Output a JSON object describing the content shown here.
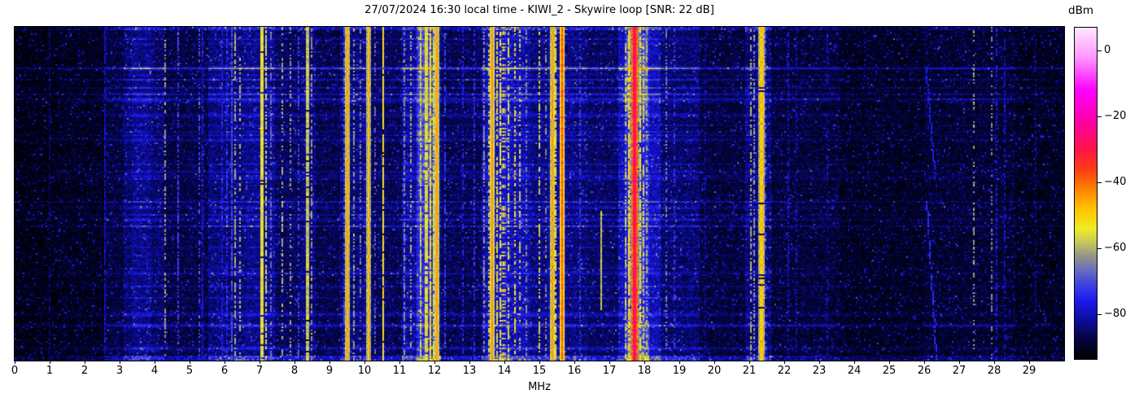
{
  "chart_data": {
    "type": "heatmap",
    "subtype": "radio-spectrogram-waterfall",
    "title": "27/07/2024 16:30 local time - KIWI_2 - Skywire loop [SNR: 22 dB]",
    "xlabel": "MHz",
    "x_range": [
      0,
      30
    ],
    "x_ticks": [
      0,
      1,
      2,
      3,
      4,
      5,
      6,
      7,
      8,
      9,
      10,
      11,
      12,
      13,
      14,
      15,
      16,
      17,
      18,
      19,
      20,
      21,
      22,
      23,
      24,
      25,
      26,
      27,
      28,
      29
    ],
    "x_tick_labels": [
      "0",
      "1",
      "2",
      "3",
      "4",
      "5",
      "6",
      "7",
      "8",
      "9",
      "10",
      "11",
      "12",
      "13",
      "14",
      "15",
      "16",
      "17",
      "18",
      "19",
      "20",
      "21",
      "22",
      "23",
      "24",
      "25",
      "26",
      "27",
      "28",
      "29"
    ],
    "grid": false,
    "legend": "none",
    "colorbar": {
      "label": "dBm",
      "vmin": -93.5,
      "vmax": 7,
      "ticks": [
        {
          "v": 0,
          "label": "0"
        },
        {
          "v": -20,
          "label": "−20"
        },
        {
          "v": -40,
          "label": "−40"
        },
        {
          "v": -60,
          "label": "−60"
        },
        {
          "v": -80,
          "label": "−80"
        }
      ]
    },
    "colormap_stops": [
      [
        -93.5,
        0,
        0,
        0
      ],
      [
        -87,
        5,
        5,
        70
      ],
      [
        -82,
        12,
        12,
        150
      ],
      [
        -76,
        25,
        25,
        235
      ],
      [
        -71,
        60,
        65,
        225
      ],
      [
        -66,
        110,
        115,
        185
      ],
      [
        -62,
        150,
        150,
        135
      ],
      [
        -58,
        200,
        200,
        90
      ],
      [
        -54,
        240,
        235,
        40
      ],
      [
        -48,
        255,
        195,
        0
      ],
      [
        -42,
        255,
        130,
        0
      ],
      [
        -36,
        255,
        60,
        20
      ],
      [
        -30,
        255,
        20,
        70
      ],
      [
        -22,
        255,
        0,
        160
      ],
      [
        -12,
        255,
        0,
        255
      ],
      [
        -2,
        255,
        150,
        255
      ],
      [
        7,
        255,
        230,
        255
      ]
    ],
    "noise_floor_default": -91.5,
    "noise_bands": [
      [
        0,
        1.2,
        -92.5
      ],
      [
        1.2,
        2.6,
        -90.5
      ],
      [
        2.6,
        3.1,
        -88
      ],
      [
        3.1,
        4.3,
        -85
      ],
      [
        3.35,
        3.9,
        -83
      ],
      [
        4.3,
        5.55,
        -87.5
      ],
      [
        5.55,
        6.6,
        -84
      ],
      [
        6.6,
        7.45,
        -83
      ],
      [
        7.45,
        8.2,
        -86
      ],
      [
        8.2,
        8.6,
        -84.5
      ],
      [
        8.6,
        9.3,
        -87
      ],
      [
        9.3,
        10.2,
        -84.5
      ],
      [
        9.95,
        10.2,
        -83
      ],
      [
        10.2,
        11.05,
        -86.5
      ],
      [
        11.05,
        12.2,
        -82
      ],
      [
        11.5,
        12.03,
        -74.5
      ],
      [
        12.2,
        13.35,
        -86.5
      ],
      [
        13.35,
        14.75,
        -82
      ],
      [
        13.5,
        14.2,
        -80.5
      ],
      [
        14.75,
        16.35,
        -84
      ],
      [
        15.25,
        15.75,
        -82
      ],
      [
        16.35,
        17.25,
        -85.5
      ],
      [
        17.25,
        18.45,
        -80
      ],
      [
        17.42,
        18.12,
        -75.5
      ],
      [
        18.45,
        19.6,
        -85
      ],
      [
        19.6,
        20.9,
        -88
      ],
      [
        20.9,
        21.65,
        -84.5
      ],
      [
        21.65,
        23.6,
        -88.5
      ],
      [
        23.6,
        26.0,
        -90
      ],
      [
        26.0,
        28.6,
        -89
      ],
      [
        28.6,
        30,
        -90.5
      ]
    ],
    "hot_zones": [
      [
        11.52,
        12.0,
        0.0,
        0.48,
        4,
        6
      ],
      [
        17.45,
        18.05,
        0.02,
        0.26,
        7,
        6
      ],
      [
        17.5,
        18.0,
        0.55,
        0.8,
        5,
        5
      ],
      [
        17.45,
        18.1,
        0.88,
        1.0,
        6,
        5
      ],
      [
        13.5,
        14.65,
        0.0,
        1.0,
        1.5,
        4
      ]
    ],
    "signals": [
      [
        0.98,
        1,
        -85,
        0.7
      ],
      [
        2.57,
        1,
        -80,
        0.9
      ],
      [
        4.28,
        1,
        -62,
        0.55
      ],
      [
        4.66,
        1,
        -72,
        0.6
      ],
      [
        5.28,
        1,
        -70,
        0.45
      ],
      [
        5.35,
        1,
        -78,
        0.8
      ],
      [
        5.95,
        1,
        -76,
        0.7
      ],
      [
        6.07,
        1,
        -74,
        0.6
      ],
      [
        6.19,
        1,
        -71,
        0.85
      ],
      [
        6.31,
        1,
        -61,
        0.5
      ],
      [
        6.42,
        1,
        -60,
        0.35
      ],
      [
        7.07,
        2,
        -53,
        0.95
      ],
      [
        7.19,
        1,
        -57,
        0.6
      ],
      [
        7.32,
        1,
        -67,
        0.5
      ],
      [
        7.65,
        1,
        -60,
        0.45
      ],
      [
        7.88,
        1,
        -62,
        0.4
      ],
      [
        8.1,
        1,
        -70,
        0.5
      ],
      [
        8.35,
        2,
        -56,
        0.95
      ],
      [
        8.47,
        1,
        -63,
        0.5
      ],
      [
        9.42,
        1,
        -70,
        0.55
      ],
      [
        9.53,
        1,
        -46,
        1
      ],
      [
        9.72,
        1,
        -62,
        0.5
      ],
      [
        9.9,
        1,
        -65,
        0.4
      ],
      [
        10.05,
        1,
        -62,
        0.5
      ],
      [
        10.12,
        1,
        -48,
        1
      ],
      [
        10.32,
        1,
        -68,
        0.4
      ],
      [
        10.55,
        1,
        -53,
        0.9
      ],
      [
        11.15,
        1,
        -64,
        0.55
      ],
      [
        11.32,
        1,
        -60,
        0.5
      ],
      [
        11.6,
        1,
        -57,
        0.75
      ],
      [
        11.76,
        2,
        -54,
        0.85
      ],
      [
        11.88,
        1,
        -52,
        0.9
      ],
      [
        11.97,
        1,
        -56,
        0.8
      ],
      [
        12.06,
        1,
        -45,
        1
      ],
      [
        12.3,
        1,
        -72,
        0.55
      ],
      [
        12.83,
        1,
        -75,
        0.5
      ],
      [
        13.12,
        1,
        -74,
        0.5
      ],
      [
        13.4,
        1,
        -63,
        0.55
      ],
      [
        13.57,
        1,
        -58,
        0.6
      ],
      [
        13.67,
        1,
        -44,
        1
      ],
      [
        13.78,
        1,
        -56,
        0.65
      ],
      [
        13.87,
        1,
        -54,
        0.7
      ],
      [
        13.97,
        1,
        -50,
        0.4
      ],
      [
        14.12,
        1,
        -56,
        0.55
      ],
      [
        14.3,
        1,
        -52,
        0.45
      ],
      [
        14.45,
        1,
        -57,
        0.4
      ],
      [
        14.62,
        1,
        -64,
        0.4
      ],
      [
        14.98,
        1,
        -58,
        0.55
      ],
      [
        15.2,
        1,
        -63,
        0.4
      ],
      [
        15.35,
        1,
        -45,
        1
      ],
      [
        15.47,
        1,
        -54,
        0.75
      ],
      [
        15.63,
        1,
        -38,
        1
      ],
      [
        16.15,
        1,
        -72,
        0.5
      ],
      [
        16.75,
        1,
        -58,
        1,
        [
          0.55,
          0.85
        ]
      ],
      [
        17.47,
        1,
        -58,
        0.6
      ],
      [
        17.56,
        1,
        -54,
        0.8
      ],
      [
        17.63,
        1,
        -49,
        0.9
      ],
      [
        17.7,
        2,
        -27,
        1
      ],
      [
        17.79,
        1,
        -50,
        0.9
      ],
      [
        17.89,
        1,
        -54,
        0.8
      ],
      [
        17.98,
        1,
        -57,
        0.6
      ],
      [
        18.08,
        1,
        -60,
        0.5
      ],
      [
        18.65,
        1,
        -66,
        0.45
      ],
      [
        18.85,
        1,
        -72,
        0.4
      ],
      [
        19.75,
        1,
        -82,
        0.5
      ],
      [
        21.05,
        1,
        -60,
        0.55
      ],
      [
        21.14,
        1,
        -63,
        0.5
      ],
      [
        21.33,
        2,
        -47,
        0.95
      ],
      [
        21.47,
        1,
        -70,
        0.4
      ],
      [
        22.12,
        1,
        -78,
        0.5
      ],
      [
        22.35,
        1,
        -80,
        0.45
      ],
      [
        23.25,
        1,
        -81,
        0.4
      ],
      [
        27.4,
        1,
        -62,
        0.3
      ],
      [
        27.92,
        1,
        -64,
        0.35
      ],
      [
        28.05,
        1,
        -77,
        0.5
      ],
      [
        28.32,
        1,
        -79,
        0.5
      ],
      [
        29.2,
        1,
        -83,
        0.5
      ]
    ],
    "drift_segments": [
      {
        "t0": 0.12,
        "t1": 0.46,
        "f0": 26.03,
        "f1": 26.3,
        "lvl": -76
      },
      {
        "t0": 0.52,
        "t1": 1.0,
        "f0": 26.05,
        "f1": 26.33,
        "lvl": -74
      }
    ],
    "streaks": {
      "strong": [
        {
          "t": 0.122,
          "boost": 13,
          "floor": -79
        },
        {
          "t": 0.217,
          "boost": 10,
          "floor": -81
        },
        {
          "t": 0.34,
          "boost": 7
        },
        {
          "t": 0.578,
          "boost": 8
        },
        {
          "t": 0.74,
          "boost": 6
        },
        {
          "t": 0.898,
          "boost": 11,
          "floor": -80
        },
        {
          "t": 0.968,
          "boost": 9
        }
      ],
      "faint_count": 42
    },
    "edge_boost": 10,
    "seed": 1337
  }
}
